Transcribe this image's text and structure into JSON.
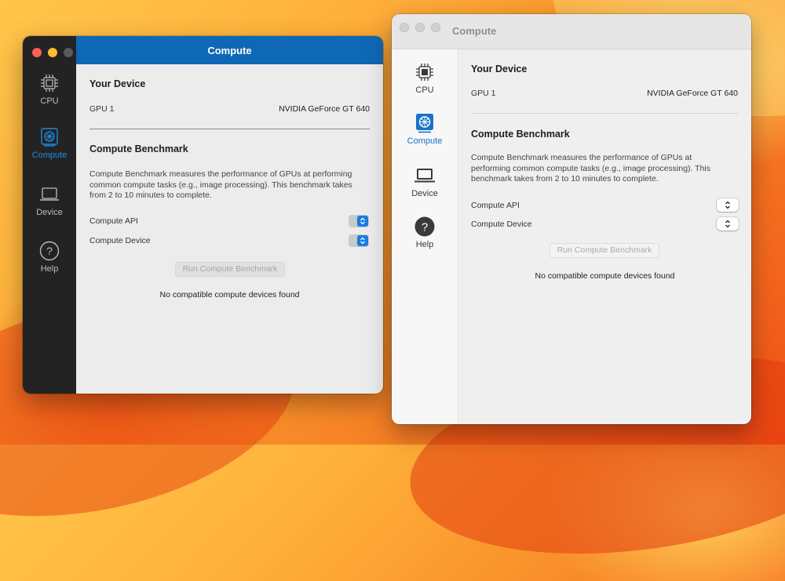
{
  "colors": {
    "accent_blue": "#0f68b6",
    "dark_sidebar": "#232323",
    "close_red": "#fe5f57",
    "minimize_yellow": "#febc2e",
    "inactive_gray": "#d1d1d1"
  },
  "dark_window": {
    "title": "Compute",
    "sidebar": [
      {
        "label": "CPU",
        "icon": "cpu-chip-icon",
        "active": false
      },
      {
        "label": "Compute",
        "icon": "gpu-card-icon",
        "active": true
      },
      {
        "label": "Device",
        "icon": "laptop-icon",
        "active": false
      },
      {
        "label": "Help",
        "icon": "question-circle-icon",
        "active": false
      }
    ],
    "your_device_title": "Your Device",
    "gpu_label": "GPU 1",
    "gpu_value": "NVIDIA GeForce GT 640",
    "benchmark_title": "Compute Benchmark",
    "benchmark_description": "Compute Benchmark measures the performance of GPUs at performing common compute tasks (e.g., image processing). This benchmark takes from 2 to 10 minutes to complete.",
    "compute_api_label": "Compute API",
    "compute_device_label": "Compute Device",
    "run_button": "Run Compute Benchmark",
    "status": "No compatible compute devices found"
  },
  "light_window": {
    "title": "Compute",
    "sidebar": [
      {
        "label": "CPU",
        "icon": "cpu-chip-icon",
        "active": false
      },
      {
        "label": "Compute",
        "icon": "gpu-card-icon",
        "active": true
      },
      {
        "label": "Device",
        "icon": "laptop-icon",
        "active": false
      },
      {
        "label": "Help",
        "icon": "question-circle-icon",
        "active": false
      }
    ],
    "your_device_title": "Your Device",
    "gpu_label": "GPU 1",
    "gpu_value": "NVIDIA GeForce GT 640",
    "benchmark_title": "Compute Benchmark",
    "benchmark_description": "Compute Benchmark measures the performance of GPUs at performing common compute tasks (e.g., image processing). This benchmark takes from 2 to 10 minutes to complete.",
    "compute_api_label": "Compute API",
    "compute_device_label": "Compute Device",
    "run_button": "Run Compute Benchmark",
    "status": "No compatible compute devices found"
  }
}
